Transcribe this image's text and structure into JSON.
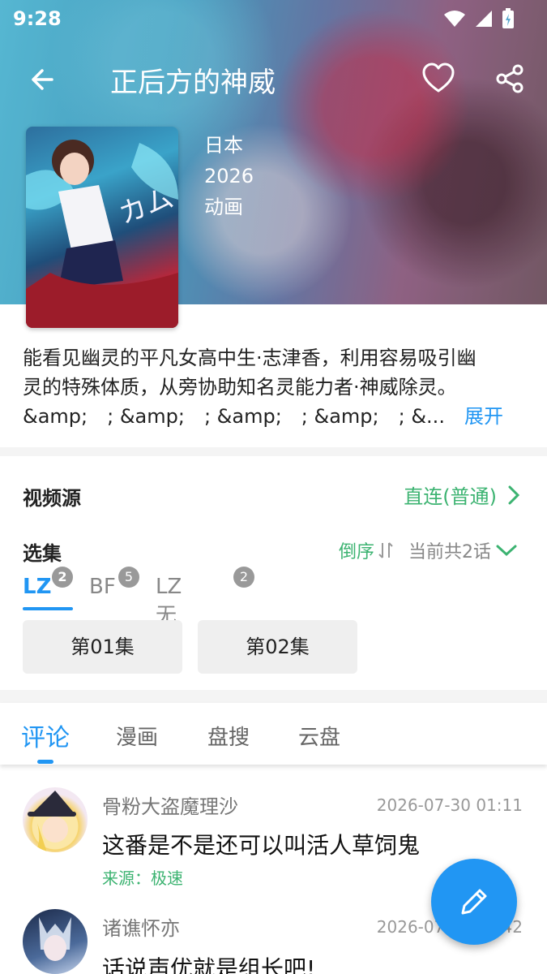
{
  "status": {
    "time": "9:28"
  },
  "header": {
    "title": "正后方的神威"
  },
  "info": {
    "country": "日本",
    "year": "2026",
    "type": "动画"
  },
  "description": {
    "text_line1": "能看见幽灵的平凡女高中生·志津香，利用容易吸引幽",
    "text_line2": "灵的特殊体质，从旁协助知名灵能力者·神威除灵。",
    "text_line3": "&amp;　; &amp;　; &amp;　; &amp;　; &...",
    "expand_label": "展开"
  },
  "source": {
    "label": "视频源",
    "value": "直连(普通)"
  },
  "episodes": {
    "label": "选集",
    "order_label": "倒序",
    "count_label": "当前共2话",
    "lines": [
      {
        "name": "LZ",
        "count": "2"
      },
      {
        "name": "BF",
        "count": "5"
      },
      {
        "name": "LZ无广",
        "count": "2"
      }
    ],
    "items": [
      "第01集",
      "第02集"
    ]
  },
  "comment_tabs": [
    "评论",
    "漫画",
    "盘搜",
    "云盘"
  ],
  "comments": [
    {
      "user": "骨粉大盗魔理沙",
      "time": "2026-07-30 01:11",
      "text": "这番是不是还可以叫活人草饲鬼",
      "source": "来源：极速"
    },
    {
      "user": "诸谯怀亦",
      "time": "2026-07-30 01:42",
      "text": "话说声优就是组长吧!"
    }
  ],
  "colors": {
    "accent": "#2196f3",
    "green": "#3cb371"
  }
}
